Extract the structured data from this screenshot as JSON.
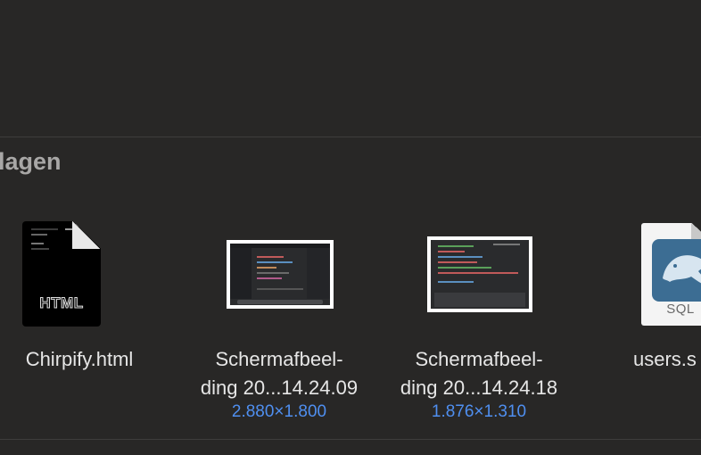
{
  "section": {
    "title": "lagen"
  },
  "files": [
    {
      "name_line1": "Chirpify.html",
      "name_line2": "",
      "dims": "",
      "icon": "html-file-icon",
      "badge": "HTML"
    },
    {
      "name_line1": "Schermafbeel-",
      "name_line2": "ding 20...14.24.09",
      "dims": "2.880×1.800",
      "icon": "screenshot-thumbnail"
    },
    {
      "name_line1": "Schermafbeel-",
      "name_line2": "ding 20...14.24.18",
      "dims": "1.876×1.310",
      "icon": "screenshot-thumbnail"
    },
    {
      "name_line1": "users.s",
      "name_line2": "",
      "dims": "",
      "icon": "sql-file-icon",
      "badge": "SQL"
    }
  ],
  "colors": {
    "background": "#282726",
    "dims_text": "#4f8ff0",
    "sql_badge": "#3c6d93"
  }
}
